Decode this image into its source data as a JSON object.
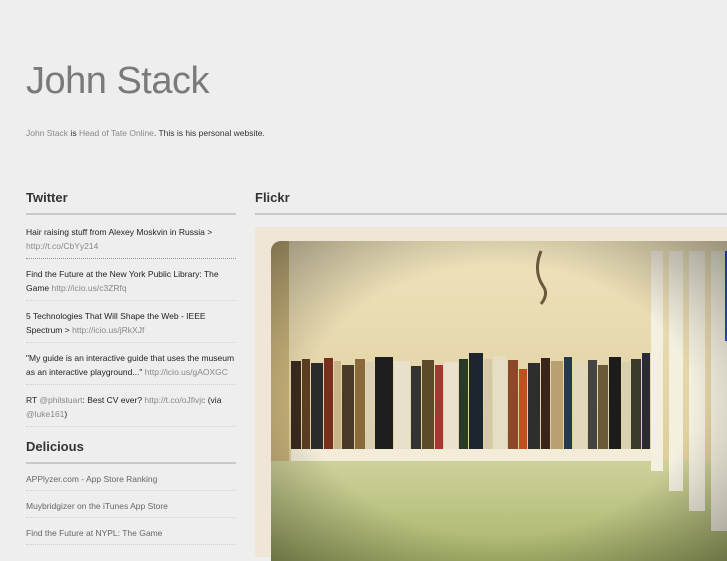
{
  "header": {
    "title": "John Stack",
    "intro_name": "John Stack",
    "intro_is": " is ",
    "intro_role": "Head of Tate Online",
    "intro_rest": ". This is his personal website."
  },
  "twitter": {
    "title": "Twitter",
    "tweets": [
      {
        "text": "Hair raising stuff from Alexey Moskvin in Russia > ",
        "link": "http://t.co/CbYy214"
      },
      {
        "text": "Find the Future at the New York Public Library: The Game ",
        "link": "http://icio.us/c3ZRfq"
      },
      {
        "text": "5 Technologies That Will Shape the Web - IEEE Spectrum > ",
        "link": "http://icio.us/jRkXJf"
      },
      {
        "text": "\"My guide is an interactive guide that uses the museum as an interactive playground...\" ",
        "link": "http://icio.us/gAOXGC"
      },
      {
        "pre": "RT ",
        "user": "@philstuart",
        "text": ": Best CV ever? ",
        "link": "http://t.co/oJfivjc",
        "via": " (via ",
        "user2": "@luke161",
        "end": ")"
      }
    ]
  },
  "delicious": {
    "title": "Delicious",
    "links": [
      "APPlyzer.com - App Store Ranking",
      "Muybridgizer on the iTunes App Store",
      "Find the Future at NYPL: The Game"
    ]
  },
  "flickr": {
    "title": "Flickr"
  },
  "colors": {
    "background": "#eeeeee",
    "title": "#7a7a7a",
    "link": "#888888",
    "rule": "#c9c9c9"
  }
}
